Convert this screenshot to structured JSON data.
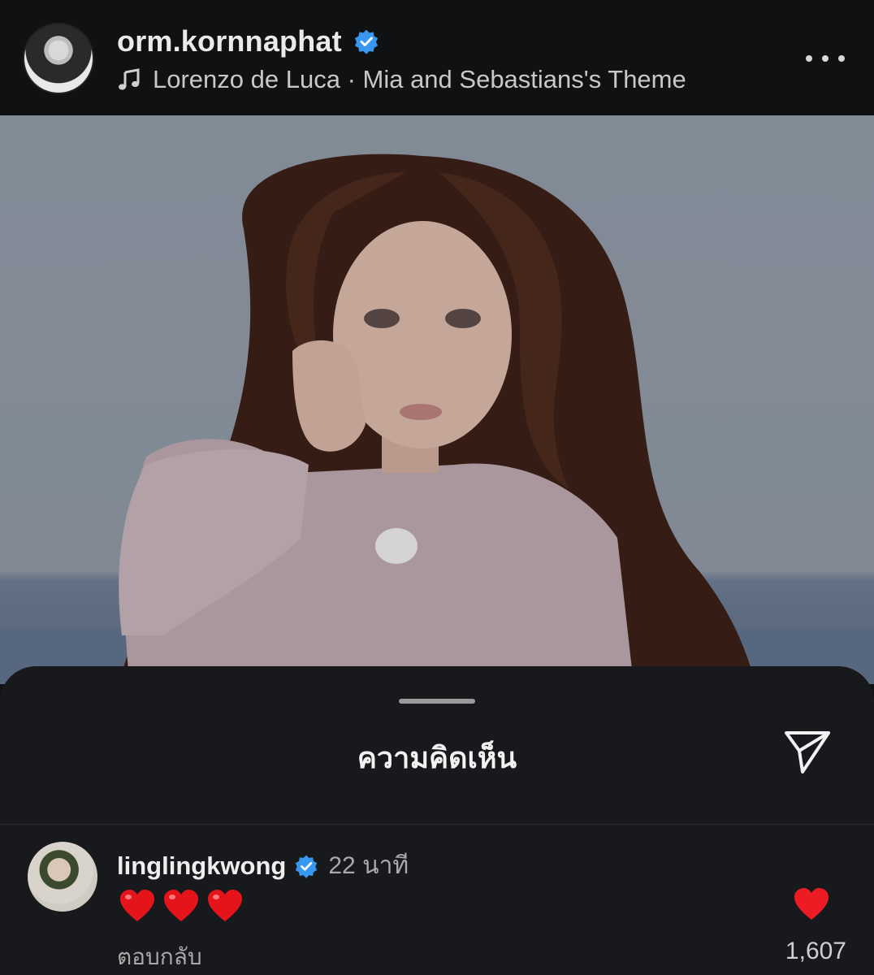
{
  "post": {
    "username": "orm.kornnaphat",
    "verified": true,
    "music": "Lorenzo de Luca · Mia and Sebastians's Theme",
    "more_icon": "more-horizontal-icon"
  },
  "sheet": {
    "title": "ความคิดเห็น",
    "share_icon": "paper-plane-icon"
  },
  "comment": {
    "username": "linglingkwong",
    "verified": true,
    "time": "22 นาที",
    "body_emoji_count": 3,
    "body_emoji": "red-heart",
    "reply_label": "ตอบกลับ",
    "liked": true,
    "like_count": "1,607"
  },
  "colors": {
    "accent_verified": "#3897f0",
    "heart": "#ed1c24",
    "sheet_bg": "#17191c"
  }
}
